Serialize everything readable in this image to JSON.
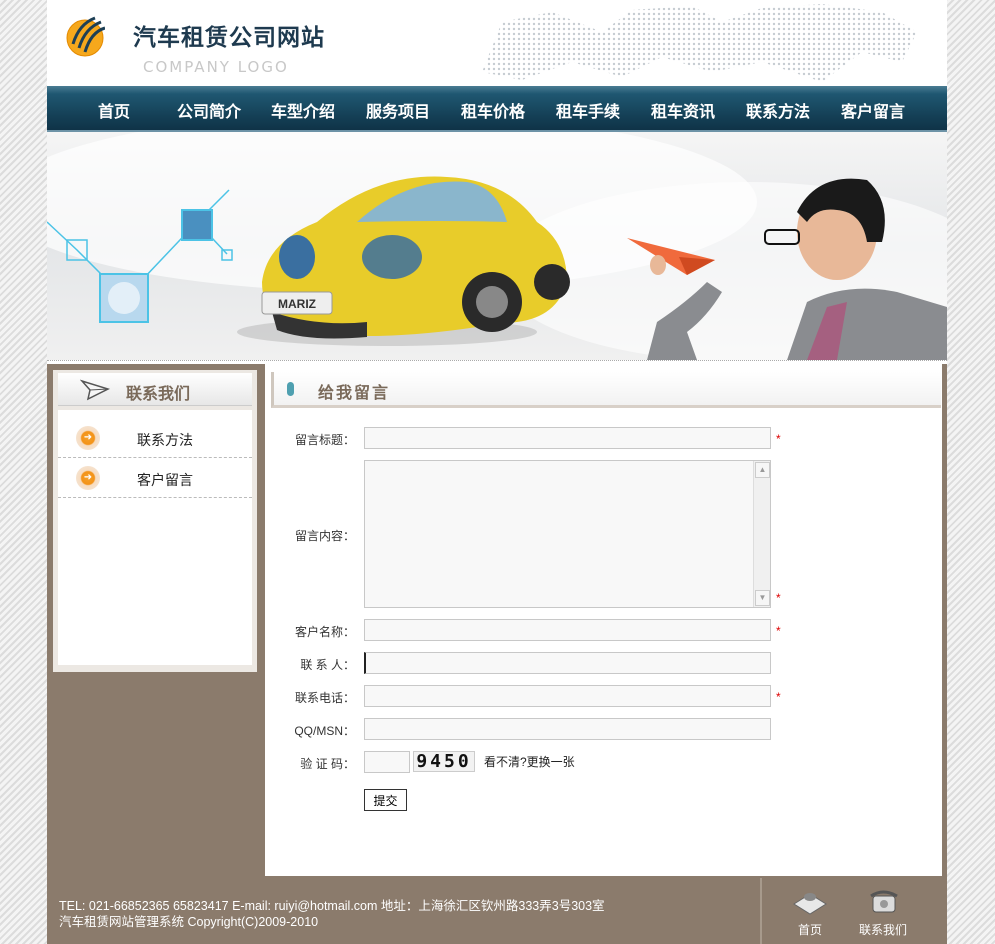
{
  "header": {
    "title": "汽车租赁公司网站",
    "logo_sub": "COMPANY LOGO"
  },
  "nav": {
    "items": [
      "首页",
      "公司简介",
      "车型介绍",
      "服务项目",
      "租车价格",
      "租车手续",
      "租车资讯",
      "联系方法",
      "客户留言"
    ]
  },
  "banner": {
    "plate": "MARIZ"
  },
  "sidebar": {
    "title": "联系我们",
    "items": [
      {
        "label": "联系方法",
        "icon": "arrow-right-icon"
      },
      {
        "label": "客户留言",
        "icon": "arrow-right-icon"
      }
    ]
  },
  "form": {
    "title": "给我留言",
    "fields": {
      "subject": {
        "label": "留言标题：",
        "value": ""
      },
      "content": {
        "label": "留言内容：",
        "value": ""
      },
      "name": {
        "label": "客户名称：",
        "value": ""
      },
      "contact": {
        "label": "联 系 人：",
        "value": ""
      },
      "phone": {
        "label": "联系电话：",
        "value": ""
      },
      "qq": {
        "label": "QQ/MSN：",
        "value": ""
      },
      "captcha": {
        "label": "验 证 码：",
        "value": ""
      }
    },
    "required_mark": "*",
    "captcha_code": "9450",
    "captcha_refresh": "看不清?更换一张",
    "submit_label": "提交"
  },
  "footer": {
    "line1": "TEL: 021-66852365 65823417 E-mail: ruiyi@hotmail.com 地址：上海徐汇区钦州路333弄3号303室",
    "line2": "汽车租赁网站管理系统  Copyright(C)2009-2010",
    "links": [
      {
        "label": "首页",
        "icon": "home-icon"
      },
      {
        "label": "联系我们",
        "icon": "telephone-icon"
      }
    ]
  },
  "colors": {
    "nav_bg": "#143f55",
    "body_brown": "#8b7b6c",
    "required": "#dd0000",
    "accent_orange": "#f39318"
  }
}
